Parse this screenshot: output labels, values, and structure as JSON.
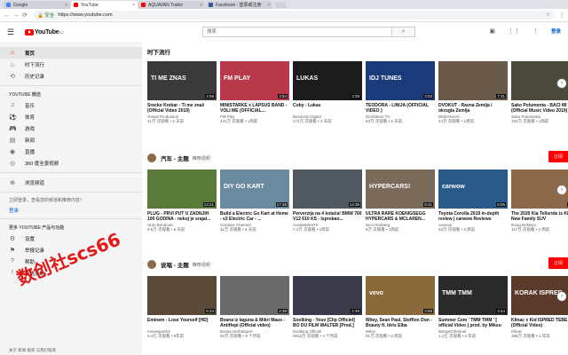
{
  "browser": {
    "tabs": [
      {
        "label": "Google",
        "color": "#4285f4",
        "active": false
      },
      {
        "label": "YouTube",
        "color": "#ff0000",
        "active": true
      },
      {
        "label": "AQUAVAN Trailer",
        "color": "#ff0000",
        "active": false
      },
      {
        "label": "Facebook - 登录或注册",
        "color": "#3b5998",
        "active": false
      }
    ],
    "secure_label": "安全",
    "url": "https://www.youtube.com"
  },
  "header": {
    "logo_text": "YouTube",
    "logo_region": "CC",
    "search_placeholder": "搜索",
    "signin_label": "登录"
  },
  "sidebar": {
    "main_items": [
      {
        "label": "首页",
        "icon": "home-icon",
        "glyph": "⌂",
        "active": true
      },
      {
        "label": "时下流行",
        "icon": "trending-icon",
        "glyph": "♨",
        "active": false
      },
      {
        "label": "历史记录",
        "icon": "history-icon",
        "glyph": "⟲",
        "active": false
      }
    ],
    "best_heading": "YOUTUBE 精选",
    "best_items": [
      {
        "label": "音乐",
        "icon": "music-icon",
        "glyph": "♫"
      },
      {
        "label": "体育",
        "icon": "sports-icon",
        "glyph": "⚽"
      },
      {
        "label": "游戏",
        "icon": "gaming-icon",
        "glyph": "🎮"
      },
      {
        "label": "新闻",
        "icon": "news-icon",
        "glyph": "▤"
      },
      {
        "label": "直播",
        "icon": "live-icon",
        "glyph": "◉"
      },
      {
        "label": "360 度全景视频",
        "icon": "360-icon",
        "glyph": "◎"
      }
    ],
    "browse_channels": {
      "label": "浏览频道",
      "icon": "browse-channels-icon",
      "glyph": "⊕"
    },
    "signin_prompt": "立即登录，查看您的频道和推荐内容！",
    "signin_link": "登录",
    "more_heading": "更多 YOUTUBE 产品与功能",
    "more_items": [
      {
        "label": "设置",
        "icon": "settings-icon",
        "glyph": "⚙"
      },
      {
        "label": "举报记录",
        "icon": "flag-icon",
        "glyph": "⚑"
      },
      {
        "label": "帮助",
        "icon": "help-icon",
        "glyph": "?"
      },
      {
        "label": "发送反馈",
        "icon": "feedback-icon",
        "glyph": "!"
      }
    ],
    "footer": "关于 新闻 版权 与我们联系"
  },
  "sections": [
    {
      "title": "时下流行",
      "subtitle": "",
      "has_avatar": false,
      "subscribe": "",
      "videos": [
        {
          "title": "Srecko Krebar - Ti me znaš (Official Video 2019)",
          "channel": "Grand Production",
          "meta": "21万 次观看 • 2 天前",
          "duration": "4:08",
          "thumb": "#3a3a3a",
          "thumb_text": "TI ME ZNAS"
        },
        {
          "title": "MINISTARKE x LAPSUS BAND - VOLI ME (OFFICIAL...",
          "channel": "FM Play",
          "meta": "441万 次观看 • 1周前",
          "duration": "3:54",
          "thumb": "#b83a4a",
          "thumb_text": "FM PLAY"
        },
        {
          "title": "Coby - Lukas",
          "channel": "Bosnivity Digital",
          "meta": "174万 次观看 • 4 天前",
          "duration": "3:29",
          "thumb": "#1c1c1c",
          "thumb_text": "LUKAS"
        },
        {
          "title": "TEODORA - LINIJA (OFFICIAL VIDEO )",
          "channel": "IDJVideos.TV",
          "meta": "63万 次观看 • 5 天前",
          "duration": "3:03",
          "thumb": "#1b3a7a",
          "thumb_text": "IDJ TUNES"
        },
        {
          "title": "DVOKUT - Ravna Zemlja i okrugla Zemlja",
          "channel": "DNEVNJAK",
          "meta": "44万 次观看 • 1周前",
          "duration": "7:31",
          "thumb": "#6a5a4a",
          "thumb_text": ""
        },
        {
          "title": "Sako Polumenta - BACI MI (Official Music Video 2019)",
          "channel": "Sako Polumenta",
          "meta": "192万 次观看 • 1周前",
          "duration": "4:55",
          "thumb": "#4a4a3a",
          "thumb_text": ""
        }
      ]
    },
    {
      "title": "汽车 - 主题",
      "subtitle": "推荐视频",
      "has_avatar": true,
      "subscribe": "订阅",
      "videos": [
        {
          "title": "PLUG - PRVI PUT U ZADNJIH 100 GODINA - nekoj je srajal...",
          "channel": "Uros Bondovic",
          "meta": "9.9万 次观看 • 6 天前",
          "duration": "13:21",
          "thumb": "#5a7a3a",
          "thumb_text": ""
        },
        {
          "title": "Build a Electric Go Kart at Home - v2 Electric Car - ...",
          "channel": "Creative Channel",
          "meta": "11万 次观看 • 6 天前",
          "duration": "17:28",
          "thumb": "#6a8aa0",
          "thumb_text": "DIY GO KART"
        },
        {
          "title": "Perverzija na 4 kotača! BMW 760 V12 610 KS - Isprobao...",
          "channel": "AutoMarketTV",
          "meta": "7.4万 次观看 • 1周前",
          "duration": "14:38",
          "thumb": "#505860",
          "thumb_text": ""
        },
        {
          "title": "ULTRA RARE KOENIGSEGG HYPERCARS & MCLAREN...",
          "channel": "Nico Rosberg",
          "meta": "8万 次观看 • 1周前",
          "duration": "9:41",
          "thumb": "#7a6a5a",
          "thumb_text": "HYPERCARS!"
        },
        {
          "title": "Toyota Corolla 2019 in-depth review | carwow Reviews",
          "channel": "carwow",
          "meta": "63万 次观看 • 3 周前",
          "duration": "8:05",
          "thumb": "#2a5a8a",
          "thumb_text": "carwow"
        },
        {
          "title": "The 2020 Kia Telluride is Kia's New Family SUV",
          "channel": "Doug DeMuro",
          "meta": "117万 次观看 • 2 周前",
          "duration": "26:39",
          "thumb": "#8a6a4a",
          "thumb_text": ""
        }
      ]
    },
    {
      "title": "说唱 - 主题",
      "subtitle": "推荐视频",
      "has_avatar": true,
      "subscribe": "订阅",
      "videos": [
        {
          "title": "Eminem - Lose Yourself [HD]",
          "channel": "movieguel23",
          "meta": "5.4亿 次观看 • 9年前",
          "duration": "5:24",
          "thumb": "#5a4a3a",
          "thumb_text": ""
        },
        {
          "title": "Bvana iz laguna & Mikri Maus - AntiHepi (Official video)",
          "channel": "Bvana Herbalajzer",
          "meta": "53万 次观看 • 9 个月前",
          "duration": "2:38",
          "thumb": "#6a6a6a",
          "thumb_text": ""
        },
        {
          "title": "Soolking - Youv [Clip Officiel] BO DU FILM WALTER [Prod.]",
          "channel": "Soolking Officiel",
          "meta": "3813万 次观看 • 4 个月前",
          "duration": "2:49",
          "thumb": "#3a3a4a",
          "thumb_text": ""
        },
        {
          "title": "Wiley, Sean Paul, Stefflon Don - Boasty ft. Idris Elba",
          "channel": "Wiley",
          "meta": "81万 次观看 • 2 周前",
          "duration": "3:59",
          "thumb": "#8a6a3a",
          "thumb_text": "vevo"
        },
        {
          "title": "Summer Cem ' TMM TMM ' [ official Video ] prod. by Miksu",
          "channel": "BangerChannel",
          "meta": "1.1亿 次观看 • 1 年前",
          "duration": "3:44",
          "thumb": "#2a2a2a",
          "thumb_text": "TMM TMM"
        },
        {
          "title": "Klinac x Kid ISPRED TEBE (Official Video)",
          "channel": "Klinac",
          "meta": "166万 次观看 • 1 年前",
          "duration": "3:30",
          "thumb": "#5a3a2a",
          "thumb_text": "KORAK ISPRED"
        }
      ]
    }
  ],
  "watermark_text": "数创社scs66"
}
